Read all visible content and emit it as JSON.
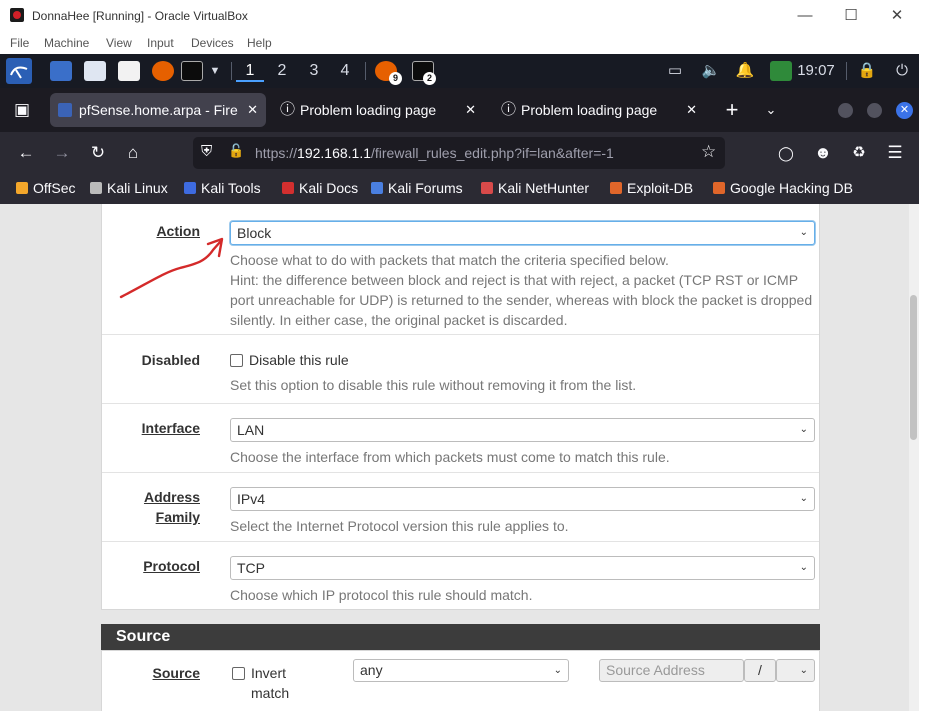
{
  "window": {
    "title": "DonnaHee [Running] - Oracle VirtualBox"
  },
  "vb_menu": [
    "File",
    "Machine",
    "View",
    "Input",
    "Devices",
    "Help"
  ],
  "kali_panel": {
    "workspaces": [
      "1",
      "2",
      "3",
      "4"
    ],
    "firefox_badge": "9",
    "terminal_badge": "2",
    "clock": "19:07"
  },
  "browser": {
    "tabs": [
      {
        "label": "pfSense.home.arpa - Fire"
      },
      {
        "label": "Problem loading page"
      },
      {
        "label": "Problem loading page"
      }
    ],
    "url_prefix": "https://",
    "url_host": "192.168.1.1",
    "url_path": "/firewall_rules_edit.php?if=lan&after=-1",
    "bookmarks": [
      "OffSec",
      "Kali Linux",
      "Kali Tools",
      "Kali Docs",
      "Kali Forums",
      "Kali NetHunter",
      "Exploit-DB",
      "Google Hacking DB"
    ]
  },
  "form": {
    "action": {
      "label": "Action",
      "value": "Block",
      "help1": "Choose what to do with packets that match the criteria specified below.",
      "help2": "Hint: the difference between block and reject is that with reject, a packet (TCP RST or ICMP port unreachable for UDP) is returned to the sender, whereas with block the packet is dropped silently. In either case, the original packet is discarded."
    },
    "disabled": {
      "label": "Disabled",
      "checkbox_label": "Disable this rule",
      "help": "Set this option to disable this rule without removing it from the list."
    },
    "interface": {
      "label": "Interface",
      "value": "LAN",
      "help": "Choose the interface from which packets must come to match this rule."
    },
    "address_family": {
      "label_line1": "Address",
      "label_line2": "Family",
      "value": "IPv4",
      "help": "Select the Internet Protocol version this rule applies to."
    },
    "protocol": {
      "label": "Protocol",
      "value": "TCP",
      "help": "Choose which IP protocol this rule should match."
    }
  },
  "source": {
    "heading": "Source",
    "label": "Source",
    "invert_line1": "Invert",
    "invert_line2": "match",
    "type_value": "any",
    "address_placeholder": "Source Address",
    "slash": "/"
  },
  "colors": {
    "annotation": "#d42a2a",
    "kali_panel": "#171a23",
    "firefox_dark": "#2b2a33",
    "section_head": "#3c3c3c"
  }
}
